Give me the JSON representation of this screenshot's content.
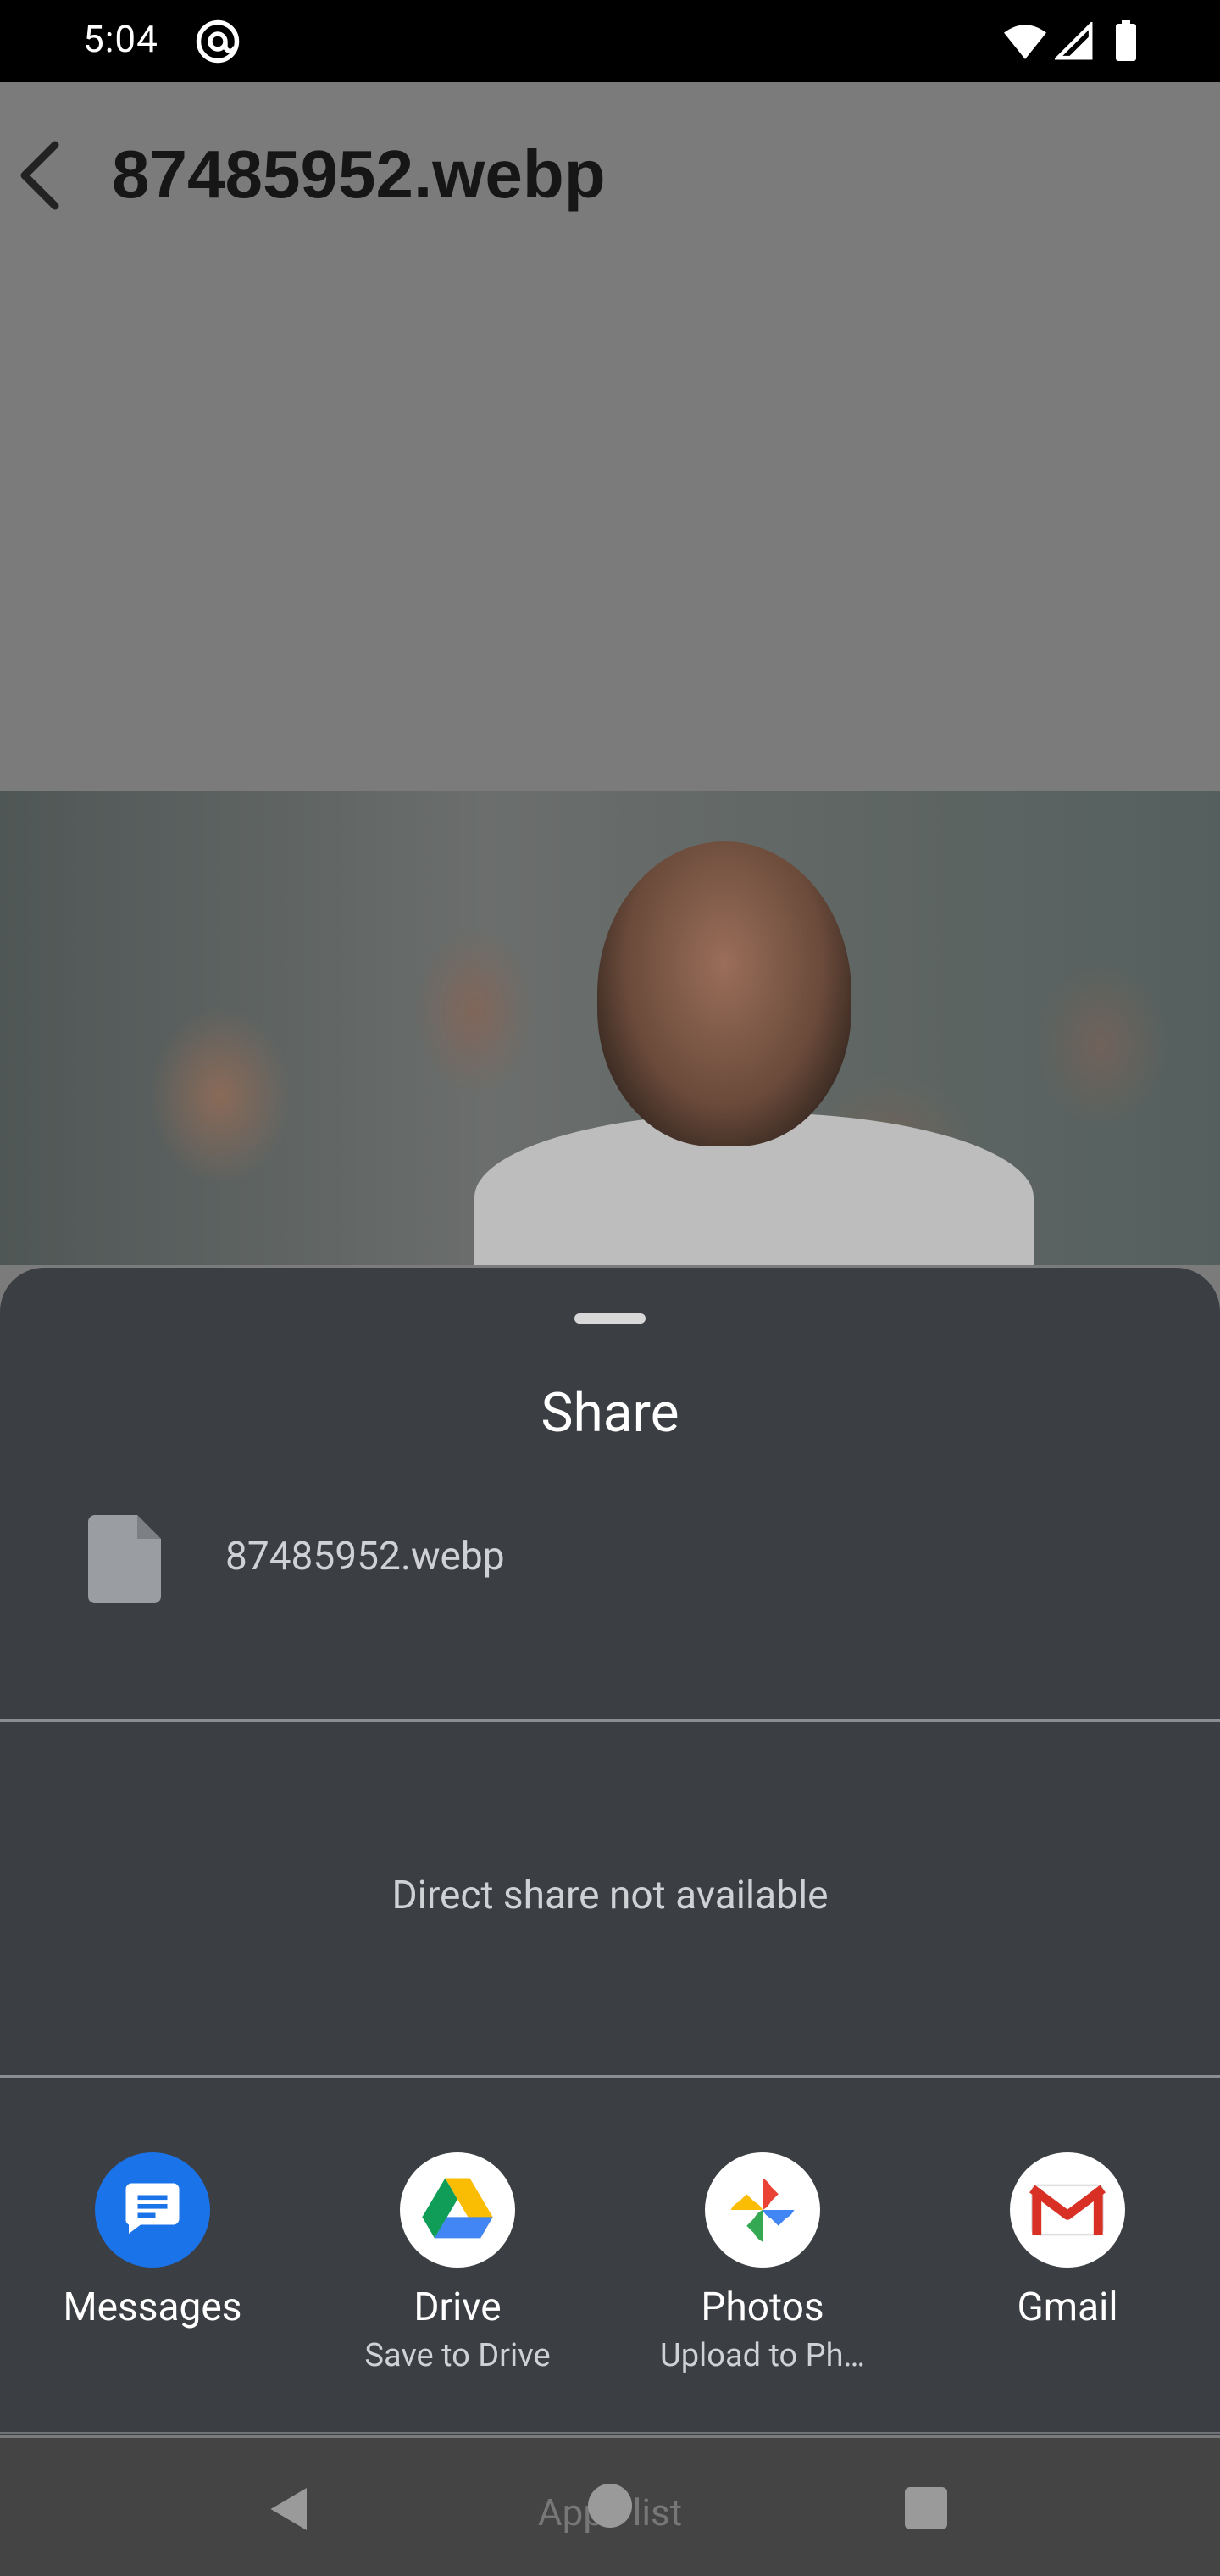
{
  "status_bar": {
    "time": "5:04",
    "icons": [
      "at-sign-icon",
      "wifi-icon",
      "signal-icon",
      "battery-icon"
    ]
  },
  "header": {
    "back_icon": "back-chevron-icon",
    "title": "87485952.webp"
  },
  "share_sheet": {
    "title": "Share",
    "file": {
      "icon": "file-icon",
      "name": "87485952.webp"
    },
    "direct_share_message": "Direct share not available",
    "apps": [
      {
        "name": "Messages",
        "subtitle": "",
        "icon": "messages-icon"
      },
      {
        "name": "Drive",
        "subtitle": "Save to Drive",
        "icon": "drive-icon"
      },
      {
        "name": "Photos",
        "subtitle": "Upload to Ph…",
        "icon": "photos-icon"
      },
      {
        "name": "Gmail",
        "subtitle": "",
        "icon": "gmail-icon"
      }
    ]
  },
  "nav_bar": {
    "hint": "Apps list",
    "buttons": [
      "nav-back-icon",
      "nav-home-icon",
      "nav-recents-icon"
    ]
  },
  "colors": {
    "sheet_bg": "#3b3e42",
    "messages_blue": "#1a73e8",
    "gmail_red": "#d93025"
  }
}
